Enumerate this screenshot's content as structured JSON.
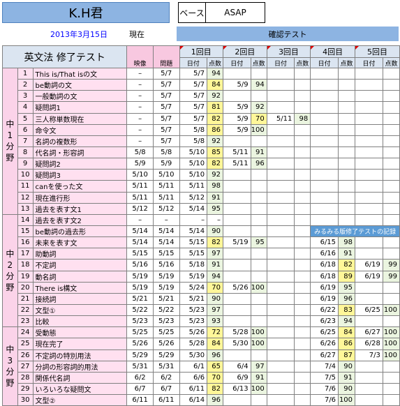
{
  "header": {
    "student": "K.H君",
    "base_label": "ベース",
    "base_value": "ASAP",
    "date": "2013年3月15日",
    "date_suffix": "現在",
    "banner": "確認テスト"
  },
  "table": {
    "title": "英文法 修了テスト",
    "col_video": "映像",
    "col_problem": "問題",
    "rounds": [
      "1回目",
      "2回目",
      "3回目",
      "4回目",
      "5回目"
    ],
    "col_date": "日付",
    "col_score": "点数",
    "note": "みるみる版修了テストの記録",
    "categories": [
      {
        "label": "中\n1\n分\n野"
      },
      {
        "label": "中\n2\n分\n野"
      },
      {
        "label": "中\n3\n分\n野"
      }
    ],
    "rows": [
      {
        "no": "1",
        "name": "This is/That isの文",
        "video": "–",
        "prob": "5/7",
        "d1": "5/7",
        "s1": "94",
        "d2": "",
        "s2": "",
        "d3": "",
        "s3": "",
        "d4": "",
        "s4": "",
        "d5": "",
        "s5": ""
      },
      {
        "no": "2",
        "name": "be動詞の文",
        "video": "–",
        "prob": "5/7",
        "d1": "5/7",
        "s1": "84",
        "d2": "5/9",
        "s2": "94",
        "d3": "",
        "s3": "",
        "d4": "",
        "s4": "",
        "d5": "",
        "s5": ""
      },
      {
        "no": "3",
        "name": "一般動詞の文",
        "video": "–",
        "prob": "5/7",
        "d1": "5/7",
        "s1": "92",
        "d2": "",
        "s2": "",
        "d3": "",
        "s3": "",
        "d4": "",
        "s4": "",
        "d5": "",
        "s5": ""
      },
      {
        "no": "4",
        "name": "疑問詞1",
        "video": "–",
        "prob": "5/7",
        "d1": "5/7",
        "s1": "81",
        "d2": "5/9",
        "s2": "92",
        "d3": "",
        "s3": "",
        "d4": "",
        "s4": "",
        "d5": "",
        "s5": ""
      },
      {
        "no": "5",
        "name": "三人称単数現在",
        "video": "–",
        "prob": "5/7",
        "d1": "5/7",
        "s1": "82",
        "d2": "5/9",
        "s2": "70",
        "d3": "5/11",
        "s3": "98",
        "d4": "",
        "s4": "",
        "d5": "",
        "s5": ""
      },
      {
        "no": "6",
        "name": "命令文",
        "video": "–",
        "prob": "5/7",
        "d1": "5/8",
        "s1": "86",
        "d2": "5/9",
        "s2": "100",
        "d3": "",
        "s3": "",
        "d4": "",
        "s4": "",
        "d5": "",
        "s5": ""
      },
      {
        "no": "7",
        "name": "名詞の複数形",
        "video": "–",
        "prob": "5/7",
        "d1": "5/8",
        "s1": "92",
        "d2": "",
        "s2": "",
        "d3": "",
        "s3": "",
        "d4": "",
        "s4": "",
        "d5": "",
        "s5": ""
      },
      {
        "no": "8",
        "name": "代名詞・形容詞",
        "video": "5/8",
        "prob": "5/8",
        "d1": "5/10",
        "s1": "85",
        "d2": "5/11",
        "s2": "91",
        "d3": "",
        "s3": "",
        "d4": "",
        "s4": "",
        "d5": "",
        "s5": ""
      },
      {
        "no": "9",
        "name": "疑問詞2",
        "video": "5/9",
        "prob": "5/9",
        "d1": "5/10",
        "s1": "82",
        "d2": "5/11",
        "s2": "96",
        "d3": "",
        "s3": "",
        "d4": "",
        "s4": "",
        "d5": "",
        "s5": ""
      },
      {
        "no": "10",
        "name": "疑問詞3",
        "video": "5/10",
        "prob": "5/10",
        "d1": "5/10",
        "s1": "92",
        "d2": "",
        "s2": "",
        "d3": "",
        "s3": "",
        "d4": "",
        "s4": "",
        "d5": "",
        "s5": ""
      },
      {
        "no": "11",
        "name": "canを使った文",
        "video": "5/11",
        "prob": "5/11",
        "d1": "5/11",
        "s1": "98",
        "d2": "",
        "s2": "",
        "d3": "",
        "s3": "",
        "d4": "",
        "s4": "",
        "d5": "",
        "s5": ""
      },
      {
        "no": "12",
        "name": "現在進行形",
        "video": "5/11",
        "prob": "5/11",
        "d1": "5/12",
        "s1": "91",
        "d2": "",
        "s2": "",
        "d3": "",
        "s3": "",
        "d4": "",
        "s4": "",
        "d5": "",
        "s5": ""
      },
      {
        "no": "13",
        "name": "過去を表す文1",
        "video": "5/12",
        "prob": "5/12",
        "d1": "5/14",
        "s1": "95",
        "d2": "",
        "s2": "",
        "d3": "",
        "s3": "",
        "d4": "",
        "s4": "",
        "d5": "",
        "s5": ""
      },
      {
        "no": "14",
        "name": "過去を表す文2",
        "video": "–",
        "prob": "–",
        "d1": "–",
        "s1": "–",
        "d2": "",
        "s2": "",
        "d3": "",
        "s3": "",
        "d4": "",
        "s4": "",
        "d5": "",
        "s5": ""
      },
      {
        "no": "15",
        "name": "be動詞の過去形",
        "video": "5/14",
        "prob": "5/14",
        "d1": "5/14",
        "s1": "90",
        "d2": "",
        "s2": "",
        "d3": "",
        "s3": "",
        "d4": "",
        "s4": "",
        "d5": "",
        "s5": ""
      },
      {
        "no": "16",
        "name": "未来を表す文",
        "video": "5/14",
        "prob": "5/14",
        "d1": "5/15",
        "s1": "82",
        "d2": "5/19",
        "s2": "95",
        "d3": "",
        "s3": "",
        "d4": "6/15",
        "s4": "98",
        "d5": "",
        "s5": ""
      },
      {
        "no": "17",
        "name": "助動詞",
        "video": "5/15",
        "prob": "5/15",
        "d1": "5/15",
        "s1": "97",
        "d2": "",
        "s2": "",
        "d3": "",
        "s3": "",
        "d4": "6/16",
        "s4": "91",
        "d5": "",
        "s5": ""
      },
      {
        "no": "18",
        "name": "不定詞",
        "video": "5/16",
        "prob": "5/16",
        "d1": "5/18",
        "s1": "91",
        "d2": "",
        "s2": "",
        "d3": "",
        "s3": "",
        "d4": "6/18",
        "s4": "82",
        "d5": "6/19",
        "s5": "99"
      },
      {
        "no": "19",
        "name": "動名詞",
        "video": "5/19",
        "prob": "5/19",
        "d1": "5/19",
        "s1": "94",
        "d2": "",
        "s2": "",
        "d3": "",
        "s3": "",
        "d4": "6/18",
        "s4": "89",
        "d5": "6/19",
        "s5": "99"
      },
      {
        "no": "20",
        "name": "There is構文",
        "video": "5/19",
        "prob": "5/19",
        "d1": "5/24",
        "s1": "70",
        "d2": "5/26",
        "s2": "100",
        "d3": "",
        "s3": "",
        "d4": "6/19",
        "s4": "95",
        "d5": "",
        "s5": ""
      },
      {
        "no": "21",
        "name": "接続詞",
        "video": "5/21",
        "prob": "5/21",
        "d1": "5/21",
        "s1": "90",
        "d2": "",
        "s2": "",
        "d3": "",
        "s3": "",
        "d4": "6/19",
        "s4": "96",
        "d5": "",
        "s5": ""
      },
      {
        "no": "22",
        "name": "文型①",
        "video": "5/22",
        "prob": "5/22",
        "d1": "5/23",
        "s1": "97",
        "d2": "",
        "s2": "",
        "d3": "",
        "s3": "",
        "d4": "6/22",
        "s4": "83",
        "d5": "6/25",
        "s5": "100"
      },
      {
        "no": "23",
        "name": "比較",
        "video": "5/23",
        "prob": "5/23",
        "d1": "5/23",
        "s1": "93",
        "d2": "",
        "s2": "",
        "d3": "",
        "s3": "",
        "d4": "6/23",
        "s4": "94",
        "d5": "",
        "s5": ""
      },
      {
        "no": "24",
        "name": "受動態",
        "video": "5/25",
        "prob": "5/25",
        "d1": "5/26",
        "s1": "72",
        "d2": "5/28",
        "s2": "100",
        "d3": "",
        "s3": "",
        "d4": "6/25",
        "s4": "84",
        "d5": "6/27",
        "s5": "100"
      },
      {
        "no": "25",
        "name": "現在完了",
        "video": "5/26",
        "prob": "5/26",
        "d1": "5/28",
        "s1": "84",
        "d2": "5/30",
        "s2": "100",
        "d3": "",
        "s3": "",
        "d4": "6/26",
        "s4": "86",
        "d5": "6/28",
        "s5": "100"
      },
      {
        "no": "26",
        "name": "不定詞の特別用法",
        "video": "5/29",
        "prob": "5/29",
        "d1": "5/30",
        "s1": "96",
        "d2": "",
        "s2": "",
        "d3": "",
        "s3": "",
        "d4": "6/27",
        "s4": "87",
        "d5": "7/3",
        "s5": "100"
      },
      {
        "no": "27",
        "name": "分詞の形容詞的用法",
        "video": "5/31",
        "prob": "5/31",
        "d1": "6/1",
        "s1": "65",
        "d2": "6/4",
        "s2": "97",
        "d3": "",
        "s3": "",
        "d4": "7/4",
        "s4": "90",
        "d5": "",
        "s5": ""
      },
      {
        "no": "28",
        "name": "関係代名詞",
        "video": "6/2",
        "prob": "6/2",
        "d1": "6/6",
        "s1": "70",
        "d2": "6/9",
        "s2": "91",
        "d3": "",
        "s3": "",
        "d4": "7/5",
        "s4": "91",
        "d5": "",
        "s5": ""
      },
      {
        "no": "29",
        "name": "いろいろな疑問文",
        "video": "6/7",
        "prob": "6/7",
        "d1": "6/11",
        "s1": "82",
        "d2": "6/13",
        "s2": "100",
        "d3": "",
        "s3": "",
        "d4": "7/6",
        "s4": "90",
        "d5": "",
        "s5": ""
      },
      {
        "no": "30",
        "name": "文型②",
        "video": "6/11",
        "prob": "6/11",
        "d1": "6/14",
        "s1": "96",
        "d2": "",
        "s2": "",
        "d3": "",
        "s3": "",
        "d4": "7/6",
        "s4": "100",
        "d5": "",
        "s5": ""
      }
    ]
  },
  "colors": {
    "title_bg": "#8db4e2",
    "score_low": "#fff799",
    "score_ok": "#ebf5e0",
    "category_bg": "#fbd3e9",
    "note_bg": "#5b9bd5"
  }
}
